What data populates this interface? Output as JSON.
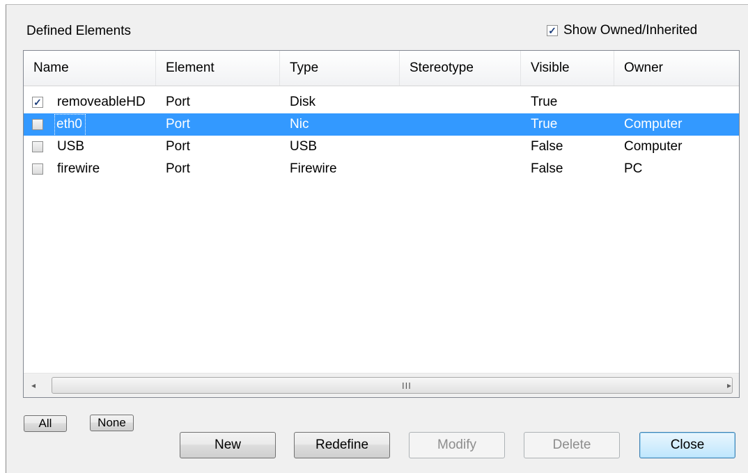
{
  "dialog": {
    "title": "Defined Elements",
    "show_owned_label": "Show Owned/Inherited",
    "show_owned_checked": true
  },
  "columns": [
    "Name",
    "Element",
    "Type",
    "Stereotype",
    "Visible",
    "Owner"
  ],
  "rows": [
    {
      "checked": true,
      "selected": false,
      "name": "removeableHD",
      "element": "Port",
      "type": "Disk",
      "stereotype": "",
      "visible": "True",
      "owner": ""
    },
    {
      "checked": false,
      "selected": true,
      "name": "eth0",
      "element": "Port",
      "type": "Nic",
      "stereotype": "",
      "visible": "True",
      "owner": "Computer"
    },
    {
      "checked": false,
      "selected": false,
      "name": "USB",
      "element": "Port",
      "type": "USB",
      "stereotype": "",
      "visible": "False",
      "owner": "Computer"
    },
    {
      "checked": false,
      "selected": false,
      "name": "firewire",
      "element": "Port",
      "type": "Firewire",
      "stereotype": "",
      "visible": "False",
      "owner": "PC"
    }
  ],
  "scrollbar": {
    "grip": "III",
    "left_arrow": "◂",
    "right_arrow": "▸"
  },
  "buttons": {
    "all": "All",
    "none": "None",
    "new": "New",
    "redefine": "Redefine",
    "modify": "Modify",
    "delete": "Delete",
    "close": "Close"
  },
  "colors": {
    "selection": "#3399ff",
    "background": "#f0f0f0"
  }
}
